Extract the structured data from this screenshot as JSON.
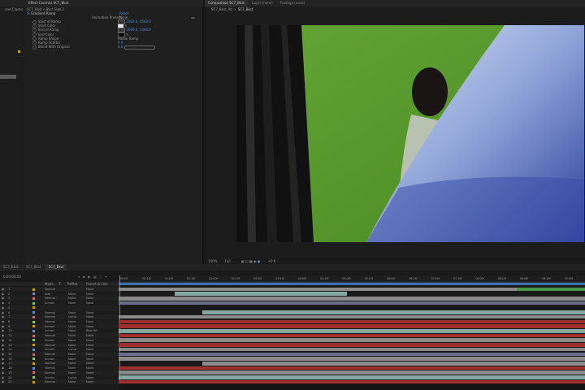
{
  "left_strip": {
    "label": "and Classic"
  },
  "effect_panel": {
    "tabs": [
      "Effect Controls SC7_Bkst"
    ],
    "breadcrumb": "SC7_Bkst • Bkst Side 2",
    "effect_name": "Gradient Ramp",
    "animation_presets_label": "Animation Presets:",
    "animation_presets_value": "None",
    "reset_label": "Reset",
    "properties": [
      {
        "label": "Start of Ramp",
        "value": "2002.0, 1560.0"
      },
      {
        "label": "Start Color",
        "value": ""
      },
      {
        "label": "End of Ramp",
        "value": "1690.0, 1440.0"
      },
      {
        "label": "End Color",
        "value": ""
      },
      {
        "label": "Ramp Shape",
        "value": "Radial Ramp"
      },
      {
        "label": "Ramp Scatter",
        "value": "0.0"
      },
      {
        "label": "Blend With Original",
        "value": "0.0"
      }
    ]
  },
  "viewer": {
    "tabs": [
      "Composition SC7_Bkst",
      "Layer (none)",
      "Footage (none)"
    ],
    "subtabs": [
      "SC7_Bkst_Alt",
      "SC7_Bkst"
    ],
    "footer": {
      "zoom": "100%",
      "resolution": "Full",
      "exposure": "+0.0"
    }
  },
  "timeline": {
    "tabs": [
      "SC7_Bkst",
      "SC7_Bkst",
      "SC7_Bkst"
    ],
    "current_time": "0;00;00;00",
    "ruler_ticks": [
      "00:00",
      "00:15f",
      "01:00f",
      "01:15f",
      "02:00f",
      "02:15f",
      "03:00f",
      "03:15f",
      "04:00f",
      "04:15f",
      "05:00f",
      "05:15f",
      "06:00f",
      "06:15f",
      "07:00f",
      "07:15f",
      "08:00f",
      "08:15f",
      "09:00f",
      "09:15f",
      "10:00f"
    ],
    "column_headers": [
      "Mode",
      "T",
      "TrkMat",
      "Parent & Link"
    ],
    "layers": [
      {
        "num": "1",
        "mode": "Normal",
        "trk": "",
        "parent": "None"
      },
      {
        "num": "2",
        "mode": "Add",
        "trk": "None",
        "parent": "None"
      },
      {
        "num": "3",
        "mode": "Normal",
        "trk": "None",
        "parent": "None"
      },
      {
        "num": "4",
        "mode": "Screen",
        "trk": "None",
        "parent": "None"
      },
      {
        "num": "5",
        "mode": "",
        "trk": "",
        "parent": ""
      },
      {
        "num": "6",
        "mode": "Normal",
        "trk": "None",
        "parent": "None"
      },
      {
        "num": "7",
        "mode": "Normal",
        "trk": "Luma",
        "parent": "None"
      },
      {
        "num": "8",
        "mode": "Normal",
        "trk": "None",
        "parent": "None"
      },
      {
        "num": "9",
        "mode": "Screen",
        "trk": "None",
        "parent": "None"
      },
      {
        "num": "10",
        "mode": "Screen",
        "trk": "None",
        "parent": "Bkst Alt"
      },
      {
        "num": "11",
        "mode": "Normal",
        "trk": "None",
        "parent": "None"
      },
      {
        "num": "12",
        "mode": "Screen",
        "trk": "None",
        "parent": "None"
      },
      {
        "num": "13",
        "mode": "Normal",
        "trk": "None",
        "parent": "None"
      },
      {
        "num": "14",
        "mode": "Screen",
        "trk": "Luma",
        "parent": "None"
      },
      {
        "num": "15",
        "mode": "Normal",
        "trk": "None",
        "parent": "None"
      },
      {
        "num": "16",
        "mode": "Screen",
        "trk": "None",
        "parent": "None"
      },
      {
        "num": "17",
        "mode": "Normal",
        "trk": "None",
        "parent": "None"
      },
      {
        "num": "18",
        "mode": "Normal",
        "trk": "None",
        "parent": "None"
      },
      {
        "num": "19",
        "mode": "Normal",
        "trk": "None",
        "parent": "None"
      },
      {
        "num": "20",
        "mode": "Screen",
        "trk": "Luma",
        "parent": "None"
      },
      {
        "num": "21",
        "mode": "Normal",
        "trk": "None",
        "parent": "None"
      }
    ]
  },
  "colors": {
    "accent": "#4a90e2",
    "green_screen": "#5a9e2e",
    "bar_gray": "#8a8a8a",
    "bar_teal": "#86a7a0",
    "bar_red": "#a03030",
    "bar_purple": "#6c6c8c",
    "bar_green": "#4a9a4a"
  }
}
